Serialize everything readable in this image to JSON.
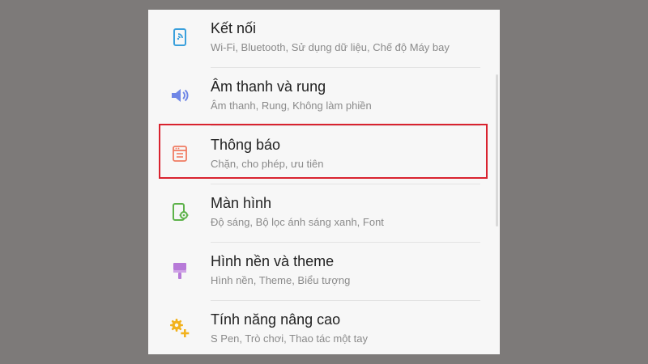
{
  "settings": {
    "items": [
      {
        "title": "Kết nối",
        "subtitle": "Wi-Fi, Bluetooth, Sử dụng dữ liệu, Chế độ Máy bay",
        "icon": "connections-icon"
      },
      {
        "title": "Âm thanh và rung",
        "subtitle": "Âm thanh, Rung, Không làm phiền",
        "icon": "speaker-icon"
      },
      {
        "title": "Thông báo",
        "subtitle": "Chặn, cho phép, ưu tiên",
        "icon": "notifications-icon"
      },
      {
        "title": "Màn hình",
        "subtitle": "Độ sáng, Bộ lọc ánh sáng xanh, Font",
        "icon": "display-settings-icon"
      },
      {
        "title": "Hình nền và theme",
        "subtitle": "Hình nền, Theme, Biểu tượng",
        "icon": "paintbrush-icon"
      },
      {
        "title": "Tính năng nâng cao",
        "subtitle": "S Pen, Trò chơi, Thao tác một tay",
        "icon": "advanced-gears-icon"
      }
    ],
    "highlighted_item": "Thông báo"
  },
  "colors": {
    "background": "#7d7a79",
    "panel": "#f7f7f7",
    "highlight_border": "#d9232f",
    "connections_icon": "#3aa0dc",
    "sound_icon": "#6f86e6",
    "notifications_icon": "#f07b62",
    "display_icon": "#5db24a",
    "wallpaper_icon": "#b77ad8",
    "advanced_icon": "#f2b21e"
  }
}
